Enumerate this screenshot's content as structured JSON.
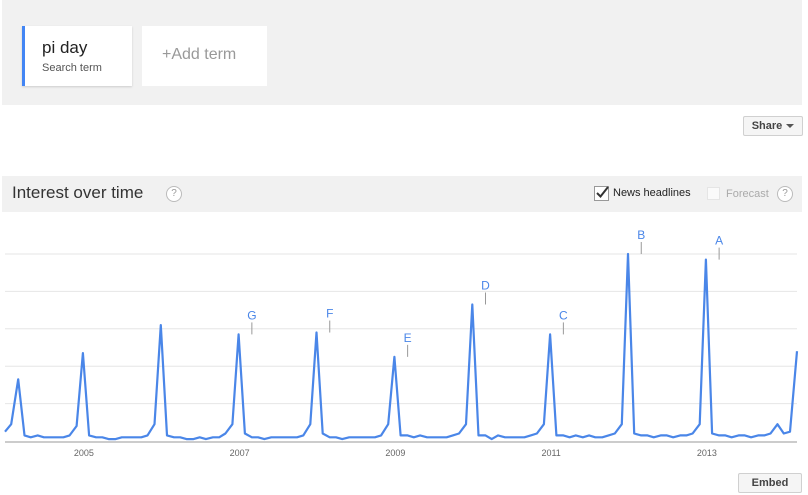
{
  "terms": {
    "term": "pi day",
    "term_sub": "Search term",
    "add_term": "+Add term"
  },
  "toolbar": {
    "share_label": "Share",
    "embed_label": "Embed"
  },
  "section": {
    "title": "Interest over time",
    "help_glyph": "?",
    "news_label": "News headlines",
    "news_checked": true,
    "forecast_label": "Forecast",
    "forecast_checked": false
  },
  "colors": {
    "line": "#4a86e8",
    "accent": "#4285f4",
    "grid": "#e6e6e6"
  },
  "chart_data": {
    "type": "line",
    "ylim": [
      0,
      100
    ],
    "x_ticks": [
      {
        "label": "2005",
        "date": 2005.0
      },
      {
        "label": "2007",
        "date": 2007.0
      },
      {
        "label": "2009",
        "date": 2009.0
      },
      {
        "label": "2011",
        "date": 2011.0
      },
      {
        "label": "2013",
        "date": 2013.0
      }
    ],
    "series": [
      {
        "x": [
          2004.0,
          2004.08,
          2004.17,
          2004.25,
          2004.33,
          2004.42,
          2004.5,
          2004.58,
          2004.67,
          2004.75,
          2004.83,
          2004.92,
          2005.0,
          2005.08,
          2005.17,
          2005.25,
          2005.33,
          2005.42,
          2005.5,
          2005.58,
          2005.67,
          2005.75,
          2005.83,
          2005.92,
          2006.0,
          2006.08,
          2006.17,
          2006.25,
          2006.33,
          2006.42,
          2006.5,
          2006.58,
          2006.67,
          2006.75,
          2006.83,
          2006.92,
          2007.0,
          2007.08,
          2007.17,
          2007.25,
          2007.33,
          2007.42,
          2007.5,
          2007.58,
          2007.67,
          2007.75,
          2007.83,
          2007.92,
          2008.0,
          2008.08,
          2008.17,
          2008.25,
          2008.33,
          2008.42,
          2008.5,
          2008.58,
          2008.67,
          2008.75,
          2008.83,
          2008.92,
          2009.0,
          2009.08,
          2009.17,
          2009.25,
          2009.33,
          2009.42,
          2009.5,
          2009.58,
          2009.67,
          2009.75,
          2009.83,
          2009.92,
          2010.0,
          2010.08,
          2010.17,
          2010.25,
          2010.33,
          2010.42,
          2010.5,
          2010.58,
          2010.67,
          2010.75,
          2010.83,
          2010.92,
          2011.0,
          2011.08,
          2011.17,
          2011.25,
          2011.33,
          2011.42,
          2011.5,
          2011.58,
          2011.67,
          2011.75,
          2011.83,
          2011.92,
          2012.0,
          2012.08,
          2012.17,
          2012.25,
          2012.33,
          2012.42,
          2012.5,
          2012.58,
          2012.67,
          2012.75,
          2012.83,
          2012.92,
          2013.0,
          2013.08,
          2013.17,
          2013.25,
          2013.33,
          2013.42,
          2013.5,
          2013.58,
          2013.67,
          2013.75,
          2013.83,
          2013.92,
          2014.0,
          2014.08,
          2014.17
        ],
        "y": [
          5,
          9,
          33,
          3,
          2,
          3,
          2,
          2,
          2,
          2,
          3,
          8,
          47,
          3,
          2,
          2,
          1,
          1,
          2,
          2,
          2,
          2,
          3,
          9,
          62,
          3,
          2,
          2,
          1,
          1,
          2,
          1,
          2,
          2,
          4,
          9,
          57,
          4,
          2,
          2,
          1,
          2,
          2,
          2,
          2,
          2,
          3,
          9,
          58,
          4,
          2,
          2,
          1,
          2,
          2,
          2,
          2,
          2,
          3,
          9,
          45,
          3,
          3,
          2,
          3,
          2,
          2,
          2,
          2,
          3,
          4,
          9,
          73,
          3,
          3,
          1,
          3,
          2,
          2,
          2,
          2,
          3,
          4,
          9,
          57,
          3,
          3,
          2,
          3,
          2,
          3,
          2,
          2,
          3,
          4,
          9,
          100,
          4,
          3,
          3,
          2,
          3,
          3,
          2,
          3,
          3,
          4,
          9,
          97,
          4,
          3,
          3,
          2,
          3,
          3,
          2,
          3,
          3,
          4,
          9,
          4,
          5,
          48
        ]
      }
    ],
    "annotations": [
      {
        "label": "G",
        "x": 2007.17,
        "y": 57
      },
      {
        "label": "F",
        "x": 2008.17,
        "y": 58
      },
      {
        "label": "E",
        "x": 2009.17,
        "y": 45
      },
      {
        "label": "D",
        "x": 2010.17,
        "y": 73
      },
      {
        "label": "C",
        "x": 2011.17,
        "y": 57
      },
      {
        "label": "B",
        "x": 2012.17,
        "y": 100
      },
      {
        "label": "A",
        "x": 2013.17,
        "y": 97
      }
    ],
    "grid": true
  }
}
